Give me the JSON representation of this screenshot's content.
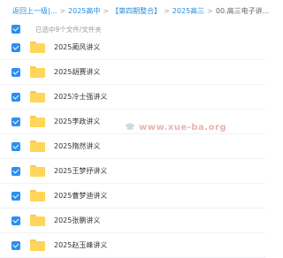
{
  "breadcrumb": {
    "items": [
      {
        "label": "返回上一级"
      },
      {
        "label": "|..."
      },
      {
        "label": "2025高中"
      },
      {
        "label": "【第四期整合】"
      },
      {
        "label": "2025高三"
      },
      {
        "label": "00.高三电子讲..."
      }
    ],
    "separator": ">"
  },
  "selection": {
    "text": "已选中9个文件/文件夹"
  },
  "files": [
    {
      "name": "2025蔺风讲义"
    },
    {
      "name": "2025胡赛讲义"
    },
    {
      "name": "2025冷士强讲义"
    },
    {
      "name": "2025李政讲义"
    },
    {
      "name": "2025隋然讲义"
    },
    {
      "name": "2025王梦抒讲义"
    },
    {
      "name": "2025曹梦迪讲义"
    },
    {
      "name": "2025张鹏讲义"
    },
    {
      "name": "2025赵玉峰讲义"
    }
  ],
  "watermark": {
    "text": "www.xue-ba.org",
    "icon": "graduation-cap-icon"
  },
  "colors": {
    "accent": "#2b8ff0",
    "link": "#1f8fe0",
    "folder": "#ffd55a"
  }
}
